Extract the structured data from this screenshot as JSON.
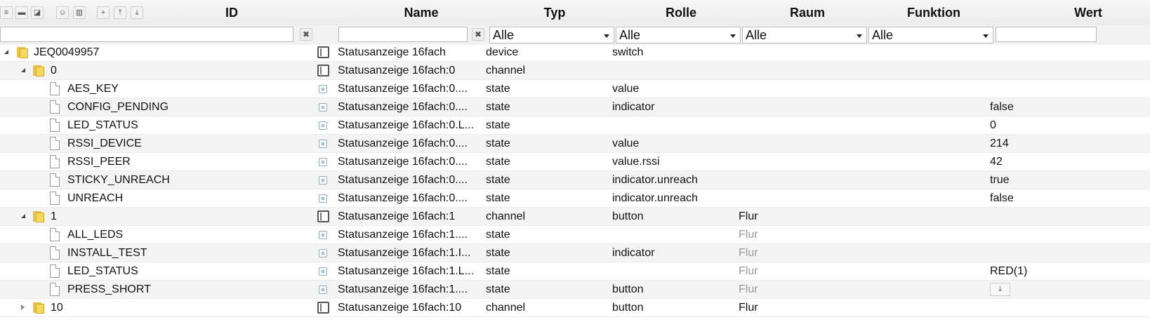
{
  "header": {
    "columns": {
      "id": "ID",
      "name": "Name",
      "typ": "Typ",
      "rolle": "Rolle",
      "raum": "Raum",
      "funktion": "Funktion",
      "wert": "Wert"
    },
    "toolbar_icons": [
      "list-icon",
      "folder-closed-icon",
      "folder-open-icon",
      "user-icon",
      "book-icon",
      "plus-icon",
      "upload-icon",
      "download-icon"
    ]
  },
  "filters": {
    "id_value": "",
    "name_value": "",
    "typ_selected": "Alle",
    "rolle_selected": "Alle",
    "raum_selected": "Alle",
    "funktion_selected": "Alle",
    "wert_value": "",
    "clear_symbol": "✖"
  },
  "rows": [
    {
      "id": "JEQ0049957",
      "name": "Statusanzeige 16fach",
      "typ": "device",
      "rolle": "switch",
      "raum": "",
      "wert": ""
    },
    {
      "id": "0",
      "name": "Statusanzeige 16fach:0",
      "typ": "channel",
      "rolle": "",
      "raum": "",
      "wert": ""
    },
    {
      "id": "AES_KEY",
      "name": "Statusanzeige 16fach:0....",
      "typ": "state",
      "rolle": "value",
      "raum": "",
      "wert": ""
    },
    {
      "id": "CONFIG_PENDING",
      "name": "Statusanzeige 16fach:0....",
      "typ": "state",
      "rolle": "indicator",
      "raum": "",
      "wert": "false"
    },
    {
      "id": "LED_STATUS",
      "name": "Statusanzeige 16fach:0.L...",
      "typ": "state",
      "rolle": "",
      "raum": "",
      "wert": "0"
    },
    {
      "id": "RSSI_DEVICE",
      "name": "Statusanzeige 16fach:0....",
      "typ": "state",
      "rolle": "value",
      "raum": "",
      "wert": "214"
    },
    {
      "id": "RSSI_PEER",
      "name": "Statusanzeige 16fach:0....",
      "typ": "state",
      "rolle": "value.rssi",
      "raum": "",
      "wert": "42"
    },
    {
      "id": "STICKY_UNREACH",
      "name": "Statusanzeige 16fach:0....",
      "typ": "state",
      "rolle": "indicator.unreach",
      "raum": "",
      "wert": "true"
    },
    {
      "id": "UNREACH",
      "name": "Statusanzeige 16fach:0....",
      "typ": "state",
      "rolle": "indicator.unreach",
      "raum": "",
      "wert": "false"
    },
    {
      "id": "1",
      "name": "Statusanzeige 16fach:1",
      "typ": "channel",
      "rolle": "button",
      "raum": "Flur",
      "wert": ""
    },
    {
      "id": "ALL_LEDS",
      "name": "Statusanzeige 16fach:1....",
      "typ": "state",
      "rolle": "",
      "raum": "Flur",
      "wert": ""
    },
    {
      "id": "INSTALL_TEST",
      "name": "Statusanzeige 16fach:1.I...",
      "typ": "state",
      "rolle": "indicator",
      "raum": "Flur",
      "wert": ""
    },
    {
      "id": "LED_STATUS",
      "name": "Statusanzeige 16fach:1.L...",
      "typ": "state",
      "rolle": "",
      "raum": "Flur",
      "wert": "RED(1)"
    },
    {
      "id": "PRESS_SHORT",
      "name": "Statusanzeige 16fach:1....",
      "typ": "state",
      "rolle": "button",
      "raum": "Flur",
      "wert": "",
      "action_icon": "download-icon"
    },
    {
      "id": "10",
      "name": "Statusanzeige 16fach:10",
      "typ": "channel",
      "rolle": "button",
      "raum": "Flur",
      "wert": ""
    }
  ]
}
